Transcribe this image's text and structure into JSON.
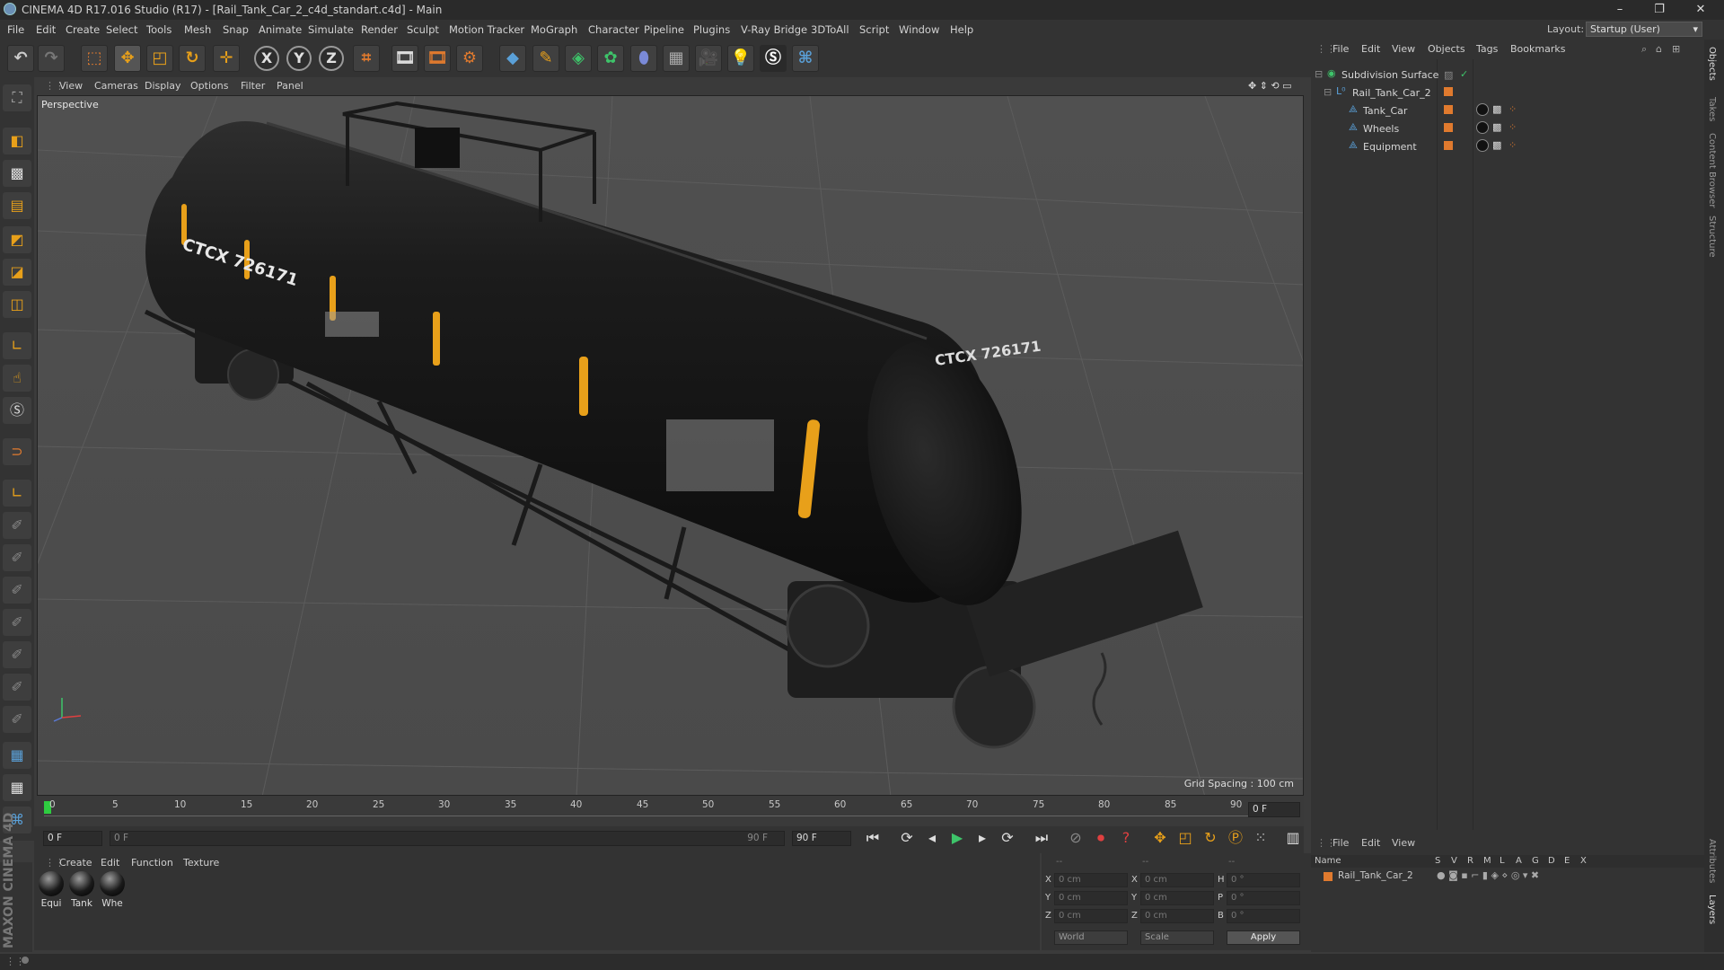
{
  "window": {
    "title": "CINEMA 4D R17.016 Studio (R17) - [Rail_Tank_Car_2_c4d_standart.c4d] - Main",
    "controls": [
      "–",
      "❐",
      "✕"
    ]
  },
  "menubar": {
    "items": [
      "File",
      "Edit",
      "Create",
      "Select",
      "Tools",
      "Mesh",
      "Snap",
      "Animate",
      "Simulate",
      "Render",
      "Sculpt",
      "Motion Tracker",
      "MoGraph",
      "Character",
      "Pipeline",
      "Plugins",
      "V-Ray Bridge",
      "3DToAll",
      "Script",
      "Window",
      "Help"
    ],
    "layout_label": "Layout:",
    "layout_value": "Startup (User)"
  },
  "toolbar": {
    "axis_x": "X",
    "axis_y": "Y",
    "axis_z": "Z"
  },
  "viewport": {
    "menu": [
      "View",
      "Cameras",
      "Display",
      "Options",
      "Filter",
      "Panel"
    ],
    "camera_label": "Perspective",
    "grid_spacing": "Grid Spacing : 100 cm",
    "tank_text_side": "CTCX 726171",
    "tank_text_end": "CTCX 726171"
  },
  "timeline": {
    "ticks": [
      "0",
      "5",
      "10",
      "15",
      "20",
      "25",
      "30",
      "35",
      "40",
      "45",
      "50",
      "55",
      "60",
      "65",
      "70",
      "75",
      "80",
      "85",
      "90"
    ],
    "current_frame": "0 F"
  },
  "playback": {
    "start_field": "0 F",
    "range_start": "0 F",
    "range_end": "90 F",
    "end_field": "90 F"
  },
  "materials": {
    "menu": [
      "Create",
      "Edit",
      "Function",
      "Texture"
    ],
    "items": [
      "Equi",
      "Tank",
      "Whe"
    ]
  },
  "coordinates": {
    "header": [
      "--",
      "--",
      "--"
    ],
    "rows": [
      {
        "a": "X",
        "av": "0 cm",
        "b": "X",
        "bv": "0 cm",
        "c": "H",
        "cv": "0 °"
      },
      {
        "a": "Y",
        "av": "0 cm",
        "b": "Y",
        "bv": "0 cm",
        "c": "P",
        "cv": "0 °"
      },
      {
        "a": "Z",
        "av": "0 cm",
        "b": "Z",
        "bv": "0 cm",
        "c": "B",
        "cv": "0 °"
      }
    ],
    "mode": "World",
    "size_mode": "Scale",
    "apply": "Apply"
  },
  "objects": {
    "menu": [
      "File",
      "Edit",
      "View",
      "Objects",
      "Tags",
      "Bookmarks"
    ],
    "tree": [
      {
        "name": "Subdivision Surface",
        "level": 0
      },
      {
        "name": "Rail_Tank_Car_2",
        "level": 1
      },
      {
        "name": "Tank_Car",
        "level": 2
      },
      {
        "name": "Wheels",
        "level": 2
      },
      {
        "name": "Equipment",
        "level": 2
      }
    ]
  },
  "attributes": {
    "menu": [
      "File",
      "Edit",
      "View"
    ],
    "columns": [
      "Name",
      "S",
      "V",
      "R",
      "M",
      "L",
      "A",
      "G",
      "D",
      "E",
      "X"
    ],
    "row": "Rail_Tank_Car_2"
  },
  "side_tabs": [
    "Objects",
    "Takes",
    "Content Browser",
    "Structure",
    "Attributes",
    "Layers"
  ],
  "branding": "MAXON CINEMA 4D",
  "colors": {
    "accent_orange": "#e07a2e",
    "object_icon_blue": "#5aa0d8",
    "tank_black": "#141414",
    "tank_stripe": "#e8a01a",
    "active_frame_green": "#2ecc40"
  }
}
